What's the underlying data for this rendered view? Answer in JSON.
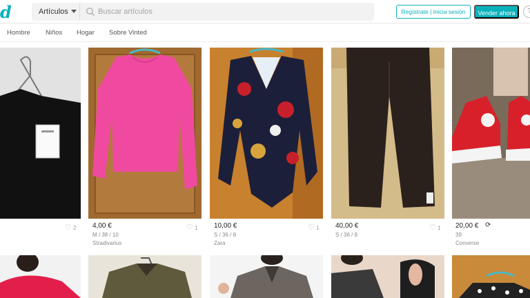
{
  "brand": {
    "logo_text": "d",
    "color": "#09b1ba"
  },
  "header": {
    "category_label": "Artículos",
    "search_placeholder": "Buscar artículos",
    "register_label": "Regístrate | Inicia sesión",
    "sell_label": "Vender ahora",
    "help_label": "?"
  },
  "nav": {
    "items": [
      "Hombre",
      "Niños",
      "Hogar",
      "Sobre Vinted"
    ]
  },
  "items": [
    {
      "price": "",
      "size": "",
      "brand": "",
      "favorites": "2",
      "photo": "white-shirt-on-hanger"
    },
    {
      "price": "4,00 €",
      "size": "M / 38 / 10",
      "brand": "Stradivarius",
      "favorites": "1",
      "photo": "pink-knit-sweater"
    },
    {
      "price": "10,00 €",
      "size": "S / 36 / 8",
      "brand": "Zara",
      "favorites": "1",
      "photo": "printed-bodysuit"
    },
    {
      "price": "40,00 €",
      "size": "S / 36 / 8",
      "brand": "",
      "favorites": "1",
      "photo": "brown-leather-trousers"
    },
    {
      "price": "20,00 €",
      "size": "39",
      "brand": "Converse",
      "favorites": "",
      "photo": "red-converse-sneakers"
    }
  ],
  "row2_photos": [
    "pink-top",
    "olive-jacket",
    "grey-blazer",
    "black-lace-top",
    "polka-dot-top"
  ]
}
